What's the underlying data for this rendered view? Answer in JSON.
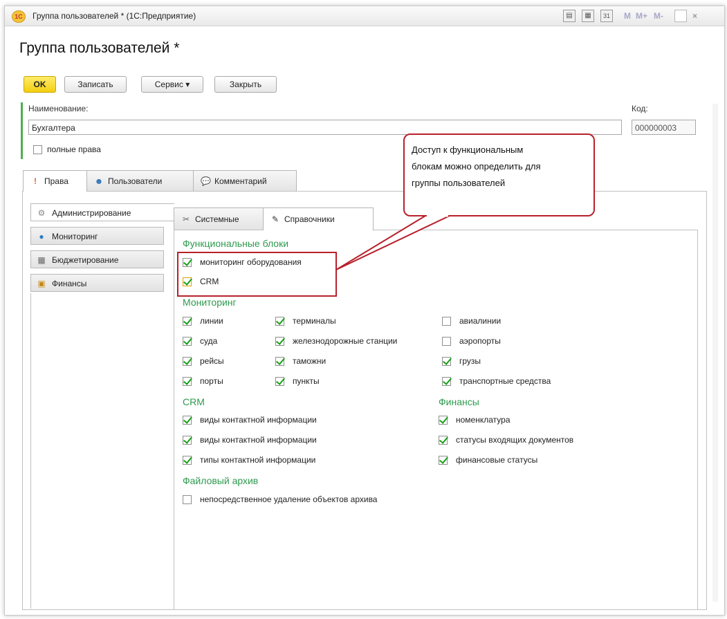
{
  "window": {
    "title": "Группа пользователей * (1С:Предприятие)",
    "logo": "1С"
  },
  "titlebar_icons": [
    "printer-icon",
    "calculator-icon",
    "calendar-icon"
  ],
  "titlebar_m": [
    "M",
    "M+",
    "M-"
  ],
  "page_title": "Группа пользователей *",
  "toolbar": {
    "ok": "OK",
    "save": "Записать",
    "service": "Сервис ▾",
    "close": "Закрыть"
  },
  "form": {
    "name_label": "Наименование:",
    "name_value": "Бухгалтера",
    "code_label": "Код:",
    "code_value": "000000003",
    "full_rights_label": "полные права",
    "full_rights_checked": false
  },
  "tabs": [
    {
      "label": "Права",
      "icon": "pin-icon",
      "active": true
    },
    {
      "label": "Пользователи",
      "icon": "users-icon",
      "active": false
    },
    {
      "label": "Комментарий",
      "icon": "comment-icon",
      "active": false
    }
  ],
  "vtabs": [
    {
      "label": "Администрирование",
      "icon": "gear-icon",
      "active": true
    },
    {
      "label": "Мониторинг",
      "icon": "globe-icon",
      "active": false
    },
    {
      "label": "Бюджетирование",
      "icon": "calculator-icon",
      "active": false
    },
    {
      "label": "Финансы",
      "icon": "finance-icon",
      "active": false
    }
  ],
  "itabs": [
    {
      "label": "Системные",
      "icon": "tools-icon",
      "active": false
    },
    {
      "label": "Справочники",
      "icon": "pencil-icon",
      "active": true
    }
  ],
  "sections": {
    "functional": "Функциональные блоки",
    "monitoring": "Мониторинг",
    "crm": "CRM",
    "finance": "Финансы",
    "archive": "Файловый архив"
  },
  "functional_items": [
    {
      "label": "мониторинг оборудования",
      "checked": true
    },
    {
      "label": "CRM",
      "checked": true
    }
  ],
  "monitoring_items": [
    {
      "label": "линии",
      "checked": true
    },
    {
      "label": "терминалы",
      "checked": true
    },
    {
      "label": "авиалинии",
      "checked": false
    },
    {
      "label": "суда",
      "checked": true
    },
    {
      "label": "железнодорожные станции",
      "checked": true
    },
    {
      "label": "аэропорты",
      "checked": false
    },
    {
      "label": "рейсы",
      "checked": true
    },
    {
      "label": "таможни",
      "checked": true
    },
    {
      "label": "грузы",
      "checked": true
    },
    {
      "label": "порты",
      "checked": true
    },
    {
      "label": "пункты",
      "checked": true
    },
    {
      "label": "транспортные средства",
      "checked": true
    }
  ],
  "crm_items": [
    {
      "label": "виды контактной информации",
      "checked": true
    },
    {
      "label": "виды контактной информации",
      "checked": true
    },
    {
      "label": "типы контактной информации",
      "checked": true
    }
  ],
  "finance_items": [
    {
      "label": "номенклатура",
      "checked": true
    },
    {
      "label": "статусы входящих документов",
      "checked": true
    },
    {
      "label": "финансовые статусы",
      "checked": true
    }
  ],
  "archive_items": [
    {
      "label": "непосредственное удаление объектов архива",
      "checked": false
    }
  ],
  "callout": {
    "line1": "Доступ к функциональным",
    "line2": "блокам можно определить для",
    "line3": "группы пользователей"
  },
  "colors": {
    "accent_green": "#2e9a4e",
    "callout_red": "#b8202a",
    "ok_yellow": "#f2cf10"
  }
}
